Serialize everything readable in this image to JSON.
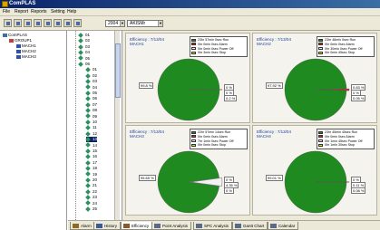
{
  "window": {
    "title": "ComPLAS"
  },
  "menu": [
    "File",
    "Report",
    "Reports",
    "Setting",
    "Help"
  ],
  "toolbar": {
    "year": "2004",
    "month": "AKISMr"
  },
  "machine_tree": {
    "root": "ComPLAS",
    "group": "GROUP1",
    "machines": [
      "MACH1",
      "MACH2",
      "MACH3"
    ]
  },
  "date_tree": {
    "months": [
      "01",
      "02",
      "03",
      "04",
      "05",
      "06"
    ],
    "days": [
      "01",
      "02",
      "03",
      "04",
      "05",
      "06",
      "07",
      "08",
      "09",
      "10",
      "11",
      "12",
      "13",
      "14",
      "15",
      "16",
      "17",
      "18",
      "19",
      "20",
      "21",
      "22",
      "23",
      "24",
      "25"
    ],
    "selected_day": "13"
  },
  "panels": [
    {
      "title": "Efficiency : 7/13/04",
      "machine": "MACH1",
      "legend": [
        "23hr 57min 0sec Run",
        "0hr 0min 0sec Alarm",
        "0hr 0min 0sec Power Off",
        "0hr 3min 0sec Stop"
      ],
      "labels": [
        "99.8 %",
        "0 %",
        "0 %",
        "0.2 %"
      ],
      "chart_data": {
        "type": "pie",
        "categories": [
          "Run",
          "Alarm",
          "Power Off",
          "Stop"
        ],
        "values": [
          99.8,
          0,
          0,
          0.2
        ]
      }
    },
    {
      "title": "Efficiency : 7/13/04",
      "machine": "MACH2",
      "legend": [
        "23hr 48min 0sec Run",
        "0hr 0min 0sec Alarm",
        "0hr 30min 0sec Power Off",
        "0hr 0min 45sec Stop"
      ],
      "labels": [
        "97.92 %",
        "0.83 %",
        "0 %",
        "0.05 %"
      ],
      "chart_data": {
        "type": "pie",
        "categories": [
          "Run",
          "Alarm",
          "Power Off",
          "Stop"
        ],
        "values": [
          97.92,
          0.83,
          0,
          0.05
        ]
      }
    },
    {
      "title": "Efficiency : 7/13/04",
      "machine": "MACH3",
      "legend": [
        "22hr 57min 14sec Run",
        "0hr 0min 0sec Alarm",
        "7hr 1min 0sec Power Off",
        "0hr 0min 0sec Stop"
      ],
      "labels": [
        "95.65 %",
        "0 %",
        "4.35 %",
        "0 %"
      ],
      "chart_data": {
        "type": "pie",
        "categories": [
          "Run",
          "Alarm",
          "Power Off",
          "Stop"
        ],
        "values": [
          95.65,
          0,
          4.35,
          0
        ]
      }
    },
    {
      "title": "Efficiency : 7/13/04",
      "machine": "MACH4",
      "legend": [
        "23hr 45min 45sec Run",
        "0hr 0min 0sec Alarm",
        "0hr 1min 45sec Power Off",
        "0hr 1min 30sec Stop"
      ],
      "labels": [
        "99.01 %",
        "0 %",
        "0.11 %",
        "0.08 %"
      ],
      "chart_data": {
        "type": "pie",
        "categories": [
          "Run",
          "Alarm",
          "Power Off",
          "Stop"
        ],
        "values": [
          99.01,
          0,
          0.11,
          0.08
        ]
      }
    }
  ],
  "colors": {
    "run": "#1f8a1f",
    "alarm": "#e02020",
    "power_off": "#f2f2f2",
    "stop": "#e8e000"
  },
  "tabs": [
    "Alarm",
    "History",
    "Efficiency",
    "Point Analysis",
    "SPC Analysis",
    "Gantt Chart",
    "Calendar"
  ]
}
